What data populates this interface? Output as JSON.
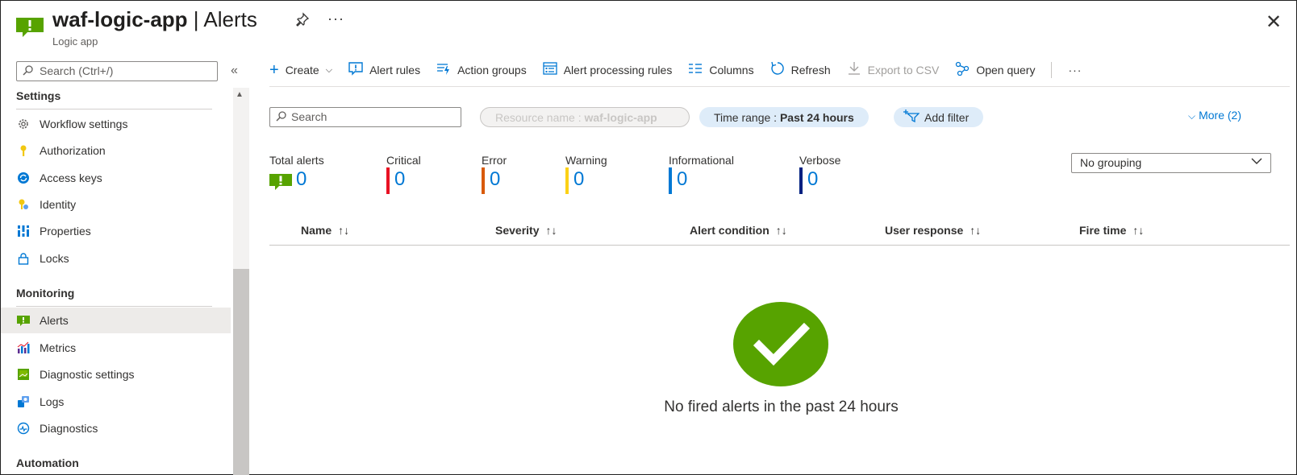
{
  "header": {
    "resource_name": "waf-logic-app",
    "page_name": "Alerts",
    "separator": "|",
    "resource_type": "Logic app",
    "more": "···",
    "close": "✕"
  },
  "nav": {
    "search_placeholder": "Search (Ctrl+/)",
    "sections": {
      "settings": "Settings",
      "monitoring": "Monitoring",
      "automation": "Automation"
    },
    "settings_items": [
      {
        "label": "Workflow settings",
        "icon": "gear-icon"
      },
      {
        "label": "Authorization",
        "icon": "key-icon"
      },
      {
        "label": "Access keys",
        "icon": "refresh-key-icon"
      },
      {
        "label": "Identity",
        "icon": "identity-icon"
      },
      {
        "label": "Properties",
        "icon": "properties-icon"
      },
      {
        "label": "Locks",
        "icon": "lock-icon"
      }
    ],
    "monitoring_items": [
      {
        "label": "Alerts",
        "icon": "alert-icon",
        "active": true
      },
      {
        "label": "Metrics",
        "icon": "metrics-icon"
      },
      {
        "label": "Diagnostic settings",
        "icon": "diagnostic-settings-icon"
      },
      {
        "label": "Logs",
        "icon": "logs-icon"
      },
      {
        "label": "Diagnostics",
        "icon": "diagnostics-icon"
      }
    ]
  },
  "toolbar": {
    "create": "Create",
    "alert_rules": "Alert rules",
    "action_groups": "Action groups",
    "alert_processing_rules": "Alert processing rules",
    "columns": "Columns",
    "refresh": "Refresh",
    "export_csv": "Export to CSV",
    "open_query": "Open query",
    "more": "···"
  },
  "filters": {
    "search_placeholder": "Search",
    "resource_label": "Resource name : ",
    "resource_value": "waf-logic-app",
    "time_label": "Time range : ",
    "time_value": "Past 24 hours",
    "add_filter": "Add filter",
    "more": "More (2)"
  },
  "summary": {
    "total": {
      "label": "Total alerts",
      "value": "0"
    },
    "critical": {
      "label": "Critical",
      "value": "0",
      "color": "#e81123"
    },
    "error": {
      "label": "Error",
      "value": "0",
      "color": "#d85a0a"
    },
    "warning": {
      "label": "Warning",
      "value": "0",
      "color": "#fcd116"
    },
    "informational": {
      "label": "Informational",
      "value": "0",
      "color": "#0078d4"
    },
    "verbose": {
      "label": "Verbose",
      "value": "0",
      "color": "#002080"
    }
  },
  "grouping": {
    "selected": "No grouping"
  },
  "table": {
    "columns": [
      "Name",
      "Severity",
      "Alert condition",
      "User response",
      "Fire time"
    ],
    "sort_glyph": "↑↓"
  },
  "empty_state": {
    "message": "No fired alerts in the past 24 hours",
    "color": "#57a300"
  }
}
